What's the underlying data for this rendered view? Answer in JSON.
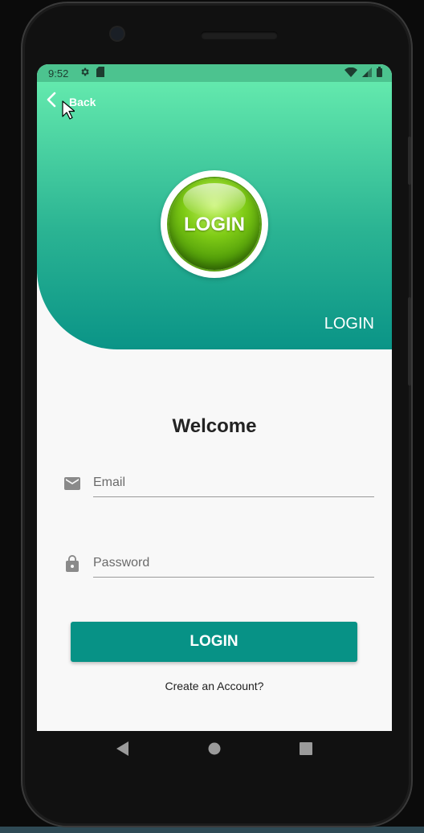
{
  "status_bar": {
    "time": "9:52",
    "background": "#4cc38f"
  },
  "header": {
    "back_label": "Back",
    "logo_text": "LOGIN",
    "title": "LOGIN",
    "gradient_top": "#63e9ad",
    "gradient_bottom": "#0a9487"
  },
  "form": {
    "welcome": "Welcome",
    "email": {
      "placeholder": "Email",
      "value": "",
      "icon": "mail-icon"
    },
    "password": {
      "placeholder": "Password",
      "value": "",
      "icon": "lock-icon"
    },
    "login_button": "LOGIN",
    "create_account": "Create an Account?",
    "accent": "#079286"
  },
  "nav": {
    "back_icon": "nav-back-icon",
    "home_icon": "nav-home-icon",
    "recents_icon": "nav-recents-icon"
  }
}
